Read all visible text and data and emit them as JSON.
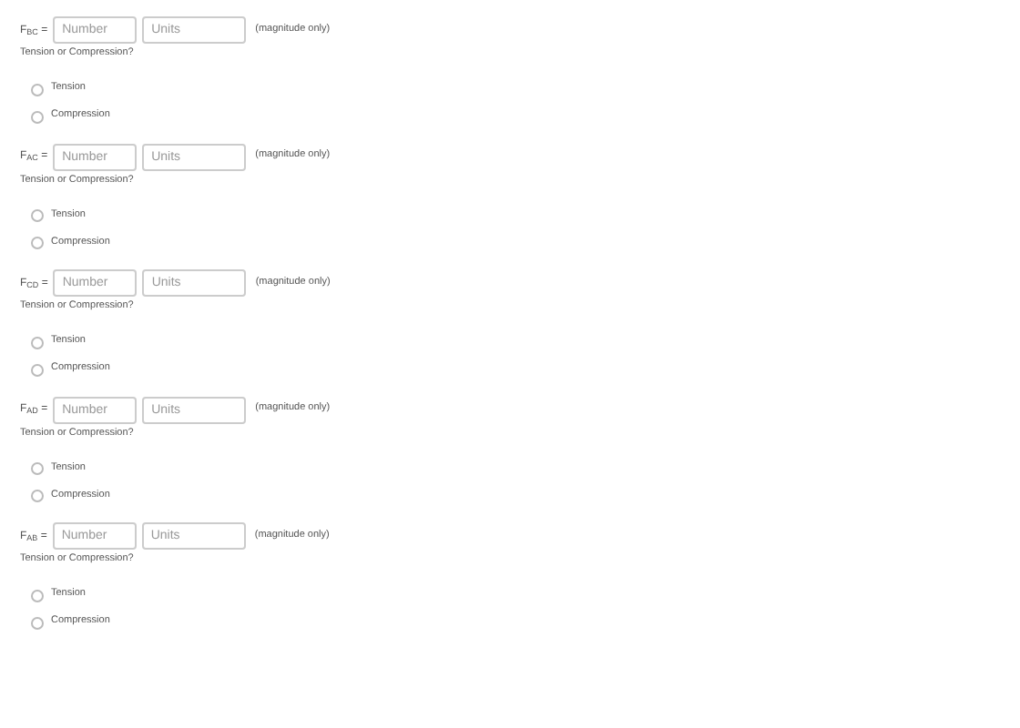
{
  "questions": [
    {
      "label": "F$_{BC}$ =",
      "number": {
        "placeholder": "Number"
      },
      "units": {
        "placeholder": "Units"
      },
      "note": "(magnitude only)",
      "prompt": "Tension or Compression?",
      "options": [
        {
          "label": "Tension",
          "selected": false
        },
        {
          "label": "Compression",
          "selected": false
        }
      ]
    },
    {
      "label": "F$_{AC}$ =",
      "number": {
        "placeholder": "Number"
      },
      "units": {
        "placeholder": "Units"
      },
      "note": "(magnitude only)",
      "prompt": "Tension or Compression?",
      "options": [
        {
          "label": "Tension",
          "selected": false
        },
        {
          "label": "Compression",
          "selected": false
        }
      ]
    },
    {
      "label": "F$_{CD}$ =",
      "number": {
        "placeholder": "Number"
      },
      "units": {
        "placeholder": "Units"
      },
      "note": "(magnitude only)",
      "prompt": "Tension or Compression?",
      "options": [
        {
          "label": "Tension",
          "selected": false
        },
        {
          "label": "Compression",
          "selected": false
        }
      ]
    },
    {
      "label": "F$_{AD}$ =",
      "number": {
        "placeholder": "Number"
      },
      "units": {
        "placeholder": "Units"
      },
      "note": "(magnitude only)",
      "prompt": "Tension or Compression?",
      "options": [
        {
          "label": "Tension",
          "selected": false
        },
        {
          "label": "Compression",
          "selected": false
        }
      ]
    },
    {
      "label": "F$_{AB}$ =",
      "number": {
        "placeholder": "Number"
      },
      "units": {
        "placeholder": "Units"
      },
      "note": "(magnitude only)",
      "prompt": "Tension or Compression?",
      "options": [
        {
          "label": "Tension",
          "selected": false
        },
        {
          "label": "Compression",
          "selected": false
        }
      ]
    }
  ]
}
